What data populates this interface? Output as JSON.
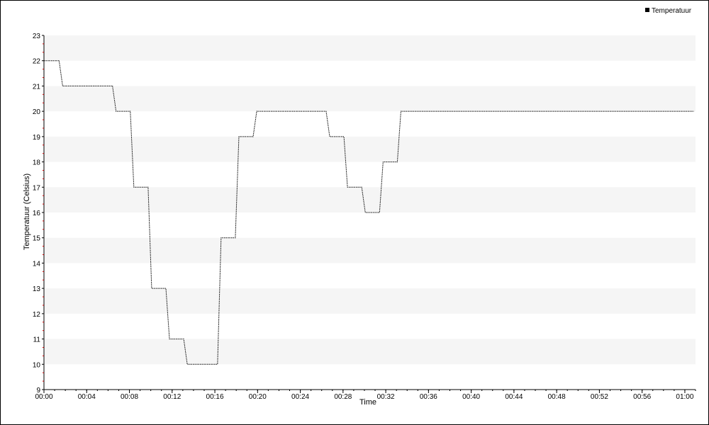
{
  "chart_data": {
    "type": "line",
    "title": "",
    "xlabel": "Time",
    "ylabel": "Temperatuur (Celsius)",
    "xlim_minutes": [
      0,
      61
    ],
    "ylim": [
      9,
      23
    ],
    "y_ticks": [
      9,
      10,
      11,
      12,
      13,
      14,
      15,
      16,
      17,
      18,
      19,
      20,
      21,
      22,
      23
    ],
    "x_ticks": [
      {
        "t": 0,
        "label": "00:00"
      },
      {
        "t": 4,
        "label": "00:04"
      },
      {
        "t": 8,
        "label": "00:08"
      },
      {
        "t": 12,
        "label": "00:12"
      },
      {
        "t": 16,
        "label": "00:16"
      },
      {
        "t": 20,
        "label": "00:20"
      },
      {
        "t": 24,
        "label": "00:24"
      },
      {
        "t": 28,
        "label": "00:28"
      },
      {
        "t": 32,
        "label": "00:32"
      },
      {
        "t": 36,
        "label": "00:36"
      },
      {
        "t": 40,
        "label": "00:40"
      },
      {
        "t": 44,
        "label": "00:44"
      },
      {
        "t": 48,
        "label": "00:48"
      },
      {
        "t": 52,
        "label": "00:52"
      },
      {
        "t": 56,
        "label": "00:56"
      },
      {
        "t": 60,
        "label": "01:00"
      }
    ],
    "grid": "alternating horizontal bands",
    "legend": {
      "position": "top-right",
      "entries": [
        "Temperatuur"
      ]
    },
    "series": [
      {
        "name": "Temperatuur",
        "color": "#000000",
        "style": "dotted",
        "points": [
          [
            "00:00:00",
            22
          ],
          [
            "00:01:25",
            22
          ],
          [
            "00:01:45",
            21
          ],
          [
            "00:06:25",
            21
          ],
          [
            "00:06:45",
            20
          ],
          [
            "00:08:05",
            20
          ],
          [
            "00:08:25",
            17
          ],
          [
            "00:09:45",
            17
          ],
          [
            "00:10:05",
            13
          ],
          [
            "00:11:25",
            13
          ],
          [
            "00:11:45",
            11
          ],
          [
            "00:13:05",
            11
          ],
          [
            "00:13:25",
            10
          ],
          [
            "00:16:15",
            10
          ],
          [
            "00:16:35",
            15
          ],
          [
            "00:17:55",
            15
          ],
          [
            "00:18:15",
            19
          ],
          [
            "00:19:35",
            19
          ],
          [
            "00:19:55",
            20
          ],
          [
            "00:26:25",
            20
          ],
          [
            "00:26:45",
            19
          ],
          [
            "00:28:05",
            19
          ],
          [
            "00:28:25",
            17
          ],
          [
            "00:29:45",
            17
          ],
          [
            "00:30:05",
            16
          ],
          [
            "00:31:25",
            16
          ],
          [
            "00:31:45",
            18
          ],
          [
            "00:33:05",
            18
          ],
          [
            "00:33:25",
            20
          ],
          [
            "01:00:50",
            20
          ]
        ]
      }
    ]
  }
}
